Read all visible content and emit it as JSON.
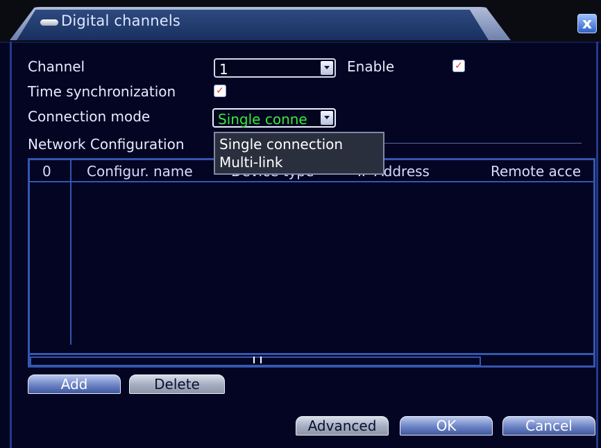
{
  "window": {
    "title": "Digital channels",
    "close_label": "x"
  },
  "form": {
    "channel_label": "Channel",
    "channel_value": "1",
    "enable_label": "Enable",
    "enable_checked": true,
    "time_sync_label": "Time synchronization",
    "time_sync_checked": true,
    "connection_mode_label": "Connection mode",
    "connection_mode_value": "Single conne",
    "network_config_label": "Network Configuration"
  },
  "dropdown": {
    "options": [
      "Single connection",
      "Multi-link"
    ]
  },
  "table": {
    "columns": [
      "0",
      "Configur. name",
      "Device type",
      "IP Address",
      "Remote acce"
    ]
  },
  "buttons": {
    "add": "Add",
    "delete": "Delete",
    "advanced": "Advanced",
    "ok": "OK",
    "cancel": "Cancel"
  },
  "colors": {
    "background": "#030522",
    "accent": "#3457b0",
    "highlight_text": "#39e639",
    "check": "#e23a2a"
  }
}
